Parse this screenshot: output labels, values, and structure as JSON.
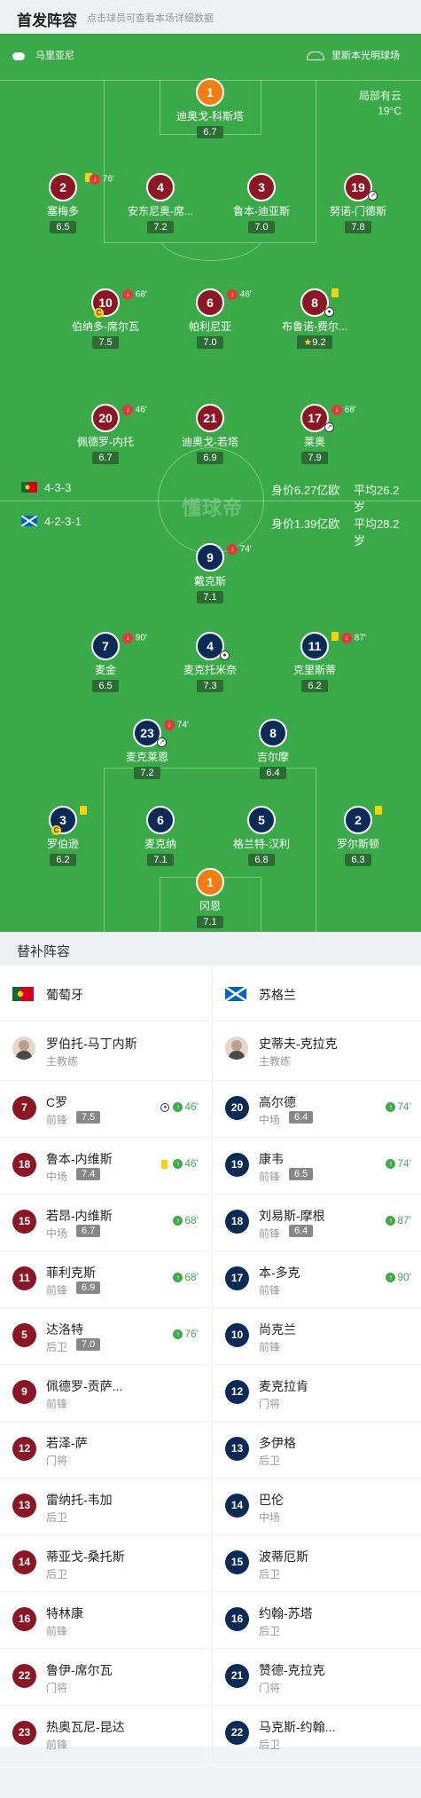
{
  "header": {
    "title": "首发阵容",
    "subtitle": "点击球员可查看本场详细数据"
  },
  "venue": {
    "referee": "马里亚尼",
    "stadium": "里斯本光明球场"
  },
  "weather": {
    "desc": "局部有云",
    "temp": "19°C"
  },
  "watermark": "懂球帝",
  "teams": {
    "home": {
      "formation": "4-3-3",
      "value": "身价6.27亿欧",
      "age": "平均26.2岁",
      "flag_colors": [
        "#0b6b2e",
        "#d6001c"
      ]
    },
    "away": {
      "formation": "4-2-3-1",
      "value": "身价1.39亿欧",
      "age": "平均28.2岁",
      "flag_colors": [
        "#0065bf",
        "#ffffff"
      ]
    }
  },
  "lineup": {
    "home": [
      {
        "num": "1",
        "name": "迪奥戈-科斯塔",
        "rating": "6.7",
        "gk": true
      },
      {
        "num": "2",
        "name": "塞梅多",
        "rating": "6.5",
        "sub": "76'",
        "yellow": true
      },
      {
        "num": "4",
        "name": "安东尼奥-席...",
        "rating": "7.2"
      },
      {
        "num": "3",
        "name": "鲁本-迪亚斯",
        "rating": "7.0"
      },
      {
        "num": "19",
        "name": "努诺-门德斯",
        "rating": "7.8",
        "assist": true
      },
      {
        "num": "10",
        "name": "伯纳多-席尔瓦",
        "rating": "7.5",
        "sub": "68'",
        "captain": true
      },
      {
        "num": "6",
        "name": "帕利尼亚",
        "rating": "7.0",
        "sub": "46'"
      },
      {
        "num": "8",
        "name": "布鲁诺-费尔...",
        "rating": "9.2",
        "yellow": true,
        "goal": true,
        "best": true
      },
      {
        "num": "20",
        "name": "佩德罗-内托",
        "rating": "6.7",
        "sub": "46'"
      },
      {
        "num": "21",
        "name": "迪奥戈-若塔",
        "rating": "6.9"
      },
      {
        "num": "17",
        "name": "莱奥",
        "rating": "7.9",
        "sub": "68'",
        "assist": true
      }
    ],
    "away": [
      {
        "num": "9",
        "name": "戴克斯",
        "rating": "7.1",
        "sub": "74'"
      },
      {
        "num": "7",
        "name": "麦金",
        "rating": "6.5",
        "sub": "90'"
      },
      {
        "num": "4",
        "name": "麦克托米奈",
        "rating": "7.3",
        "goal": true
      },
      {
        "num": "11",
        "name": "克里斯蒂",
        "rating": "6.2",
        "sub": "87'",
        "yellow": true
      },
      {
        "num": "23",
        "name": "麦克莱恩",
        "rating": "7.2",
        "sub": "74'",
        "assist": true
      },
      {
        "num": "8",
        "name": "吉尔摩",
        "rating": "6.4"
      },
      {
        "num": "3",
        "name": "罗伯逊",
        "rating": "6.2",
        "yellow": true,
        "captain": true
      },
      {
        "num": "6",
        "name": "麦克纳",
        "rating": "7.1"
      },
      {
        "num": "5",
        "name": "格兰特-汉利",
        "rating": "6.8"
      },
      {
        "num": "2",
        "name": "罗尔斯顿",
        "rating": "6.3",
        "yellow": true
      },
      {
        "num": "1",
        "name": "冈恩",
        "rating": "7.1",
        "gk": true
      }
    ]
  },
  "subs_section": {
    "title": "替补阵容",
    "home_name": "葡萄牙",
    "away_name": "苏格兰",
    "home_coach": {
      "name": "罗伯托-马丁内斯",
      "role": "主教练"
    },
    "away_coach": {
      "name": "史蒂夫-克拉克",
      "role": "主教练"
    },
    "home": [
      {
        "num": "7",
        "name": "C罗",
        "pos": "前锋",
        "rating": "7.5",
        "ev": "46'",
        "goal": true
      },
      {
        "num": "18",
        "name": "鲁本-内维斯",
        "pos": "中场",
        "rating": "7.4",
        "ev": "46'",
        "yellow": true
      },
      {
        "num": "15",
        "name": "若昂-内维斯",
        "pos": "中场",
        "rating": "6.7",
        "ev": "68'"
      },
      {
        "num": "11",
        "name": "菲利克斯",
        "pos": "前锋",
        "rating": "6.9",
        "ev": "68'"
      },
      {
        "num": "5",
        "name": "达洛特",
        "pos": "后卫",
        "rating": "7.0",
        "ev": "76'"
      },
      {
        "num": "9",
        "name": "佩德罗-贡萨...",
        "pos": "前锋"
      },
      {
        "num": "12",
        "name": "若泽-萨",
        "pos": "门将"
      },
      {
        "num": "13",
        "name": "雷纳托-韦加",
        "pos": "后卫"
      },
      {
        "num": "14",
        "name": "蒂亚戈-桑托斯",
        "pos": "后卫"
      },
      {
        "num": "16",
        "name": "特林康",
        "pos": "前锋"
      },
      {
        "num": "22",
        "name": "鲁伊-席尔瓦",
        "pos": "门将"
      },
      {
        "num": "23",
        "name": "热奥瓦尼-昆达",
        "pos": "前锋"
      }
    ],
    "away": [
      {
        "num": "20",
        "name": "高尔德",
        "pos": "中场",
        "rating": "6.4",
        "ev": "74'"
      },
      {
        "num": "19",
        "name": "康韦",
        "pos": "前锋",
        "rating": "6.5",
        "ev": "74'"
      },
      {
        "num": "18",
        "name": "刘易斯-摩根",
        "pos": "前锋",
        "rating": "6.4",
        "ev": "87'"
      },
      {
        "num": "17",
        "name": "本-多克",
        "pos": "前锋",
        "ev": "90'"
      },
      {
        "num": "10",
        "name": "尚克兰",
        "pos": "前锋"
      },
      {
        "num": "12",
        "name": "麦克拉肯",
        "pos": "门将"
      },
      {
        "num": "13",
        "name": "多伊格",
        "pos": "后卫"
      },
      {
        "num": "14",
        "name": "巴伦",
        "pos": "中场"
      },
      {
        "num": "15",
        "name": "波蒂厄斯",
        "pos": "后卫"
      },
      {
        "num": "16",
        "name": "约翰-苏塔",
        "pos": "后卫"
      },
      {
        "num": "21",
        "name": "赞德-克拉克",
        "pos": "门将"
      },
      {
        "num": "22",
        "name": "马克斯-约翰...",
        "pos": "后卫"
      }
    ]
  }
}
